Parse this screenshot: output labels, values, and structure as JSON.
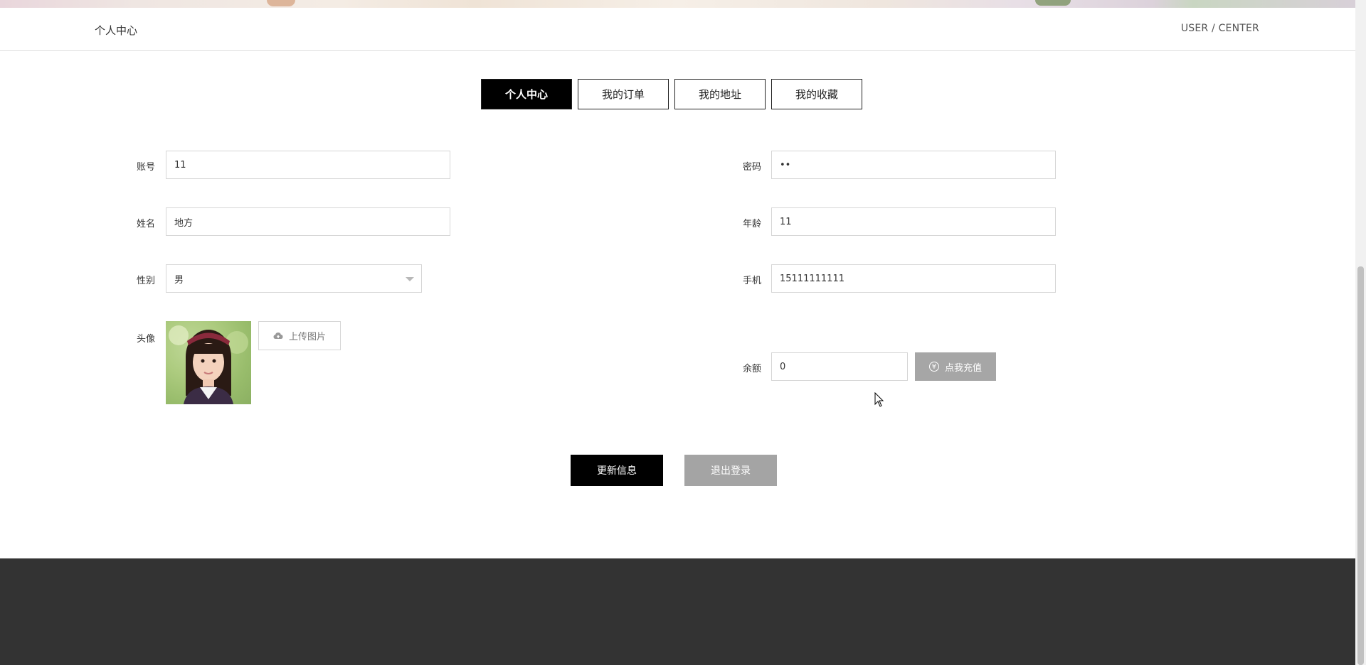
{
  "header": {
    "left_title": "个人中心",
    "right_title": "USER / CENTER"
  },
  "tabs": [
    {
      "label": "个人中心",
      "active": true
    },
    {
      "label": "我的订单",
      "active": false
    },
    {
      "label": "我的地址",
      "active": false
    },
    {
      "label": "我的收藏",
      "active": false
    }
  ],
  "form": {
    "account": {
      "label": "账号",
      "value": "11"
    },
    "password": {
      "label": "密码",
      "value": "••"
    },
    "name": {
      "label": "姓名",
      "value": "地方"
    },
    "age": {
      "label": "年龄",
      "value": "11"
    },
    "gender": {
      "label": "性别",
      "value": "男"
    },
    "phone": {
      "label": "手机",
      "value": "15111111111"
    },
    "avatar": {
      "label": "头像",
      "upload_label": "上传图片"
    },
    "balance": {
      "label": "余额",
      "value": "0",
      "recharge_label": "点我充值"
    }
  },
  "actions": {
    "update_label": "更新信息",
    "logout_label": "退出登录"
  },
  "icons": {
    "upload": "cloud-upload-icon",
    "recharge": "yen-icon",
    "select": "chevron-down-icon"
  },
  "colors": {
    "primary": "#000000",
    "secondary_button": "#a4a4a4",
    "footer": "#333333"
  }
}
